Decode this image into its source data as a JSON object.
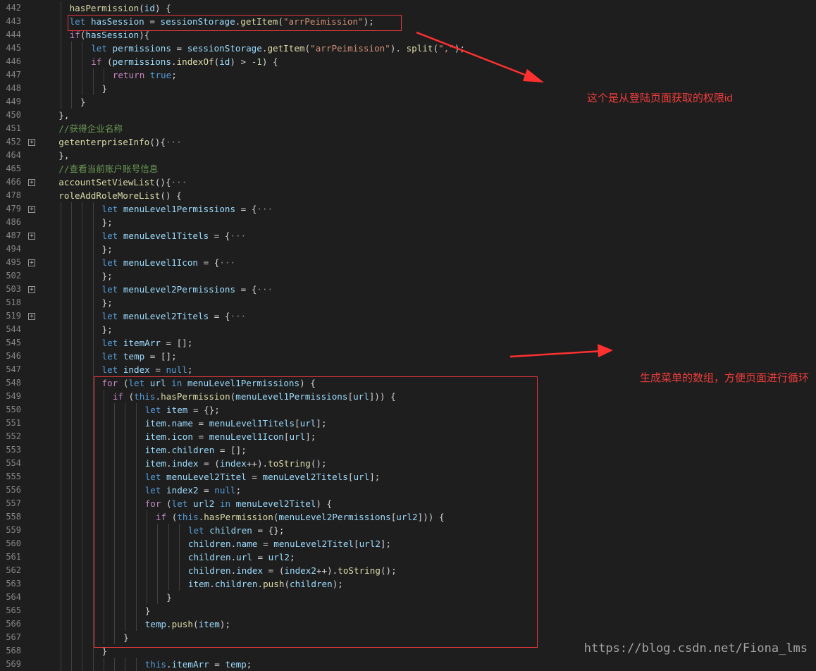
{
  "editor": {
    "lines": [
      {
        "n": "442",
        "fold": false,
        "indent": 3,
        "tokens": [
          [
            "fn",
            "hasPermission"
          ],
          [
            "p",
            "("
          ],
          [
            "vr",
            "id"
          ],
          [
            "p",
            ") {"
          ]
        ]
      },
      {
        "n": "443",
        "fold": false,
        "indent": 3,
        "tokens": [
          [
            "kw",
            "let "
          ],
          [
            "vr",
            "hasSession"
          ],
          [
            "p",
            " = "
          ],
          [
            "vr",
            "sessionStorage"
          ],
          [
            "p",
            "."
          ],
          [
            "fn",
            "getItem"
          ],
          [
            "p",
            "("
          ],
          [
            "str",
            "\"arrPeimission\""
          ],
          [
            "p",
            ");"
          ]
        ]
      },
      {
        "n": "444",
        "fold": false,
        "indent": 3,
        "tokens": [
          [
            "ctl",
            "if"
          ],
          [
            "p",
            "("
          ],
          [
            "vr",
            "hasSession"
          ],
          [
            "p",
            "){"
          ]
        ]
      },
      {
        "n": "445",
        "fold": false,
        "indent": 5,
        "tokens": [
          [
            "kw",
            "let "
          ],
          [
            "vr",
            "permissions"
          ],
          [
            "p",
            " = "
          ],
          [
            "vr",
            "sessionStorage"
          ],
          [
            "p",
            "."
          ],
          [
            "fn",
            "getItem"
          ],
          [
            "p",
            "("
          ],
          [
            "str",
            "\"arrPeimission\""
          ],
          [
            "p",
            "). "
          ],
          [
            "fn",
            "split"
          ],
          [
            "p",
            "("
          ],
          [
            "str",
            "\",\""
          ],
          [
            "p",
            ");"
          ]
        ]
      },
      {
        "n": "446",
        "fold": false,
        "indent": 5,
        "tokens": [
          [
            "ctl",
            "if "
          ],
          [
            "p",
            "("
          ],
          [
            "vr",
            "permissions"
          ],
          [
            "p",
            "."
          ],
          [
            "fn",
            "indexOf"
          ],
          [
            "p",
            "("
          ],
          [
            "vr",
            "id"
          ],
          [
            "p",
            ") > -"
          ],
          [
            "num",
            "1"
          ],
          [
            "p",
            ") {"
          ]
        ]
      },
      {
        "n": "447",
        "fold": false,
        "indent": 7,
        "tokens": [
          [
            "ctl",
            "return "
          ],
          [
            "kw",
            "true"
          ],
          [
            "p",
            ";"
          ]
        ]
      },
      {
        "n": "448",
        "fold": false,
        "indent": 6,
        "tokens": [
          [
            "p",
            "}"
          ]
        ]
      },
      {
        "n": "449",
        "fold": false,
        "indent": 4,
        "tokens": [
          [
            "p",
            "}"
          ]
        ]
      },
      {
        "n": "450",
        "fold": false,
        "indent": 2,
        "tokens": [
          [
            "p",
            "},"
          ]
        ]
      },
      {
        "n": "451",
        "fold": false,
        "indent": 2,
        "tokens": [
          [
            "cm",
            "//获得企业名称"
          ]
        ]
      },
      {
        "n": "452",
        "fold": true,
        "indent": 2,
        "tokens": [
          [
            "fn",
            "getenterpriseInfo"
          ],
          [
            "p",
            "(){"
          ],
          [
            "el",
            "···"
          ]
        ]
      },
      {
        "n": "464",
        "fold": false,
        "indent": 2,
        "tokens": [
          [
            "p",
            "},"
          ]
        ]
      },
      {
        "n": "465",
        "fold": false,
        "indent": 2,
        "tokens": [
          [
            "cm",
            "//查看当前账户账号信息"
          ]
        ]
      },
      {
        "n": "466",
        "fold": true,
        "indent": 2,
        "tokens": [
          [
            "fn",
            "accountSetViewList"
          ],
          [
            "p",
            "(){"
          ],
          [
            "el",
            "···"
          ]
        ]
      },
      {
        "n": "478",
        "fold": false,
        "indent": 2,
        "tokens": [
          [
            "fn",
            "roleAddRoleMoreList"
          ],
          [
            "p",
            "() {"
          ]
        ]
      },
      {
        "n": "479",
        "fold": true,
        "indent": 6,
        "tokens": [
          [
            "kw",
            "let "
          ],
          [
            "vr",
            "menuLevel1Permissions"
          ],
          [
            "p",
            " = {"
          ],
          [
            "el",
            "···"
          ]
        ]
      },
      {
        "n": "486",
        "fold": false,
        "indent": 6,
        "tokens": [
          [
            "p",
            "};"
          ]
        ]
      },
      {
        "n": "487",
        "fold": true,
        "indent": 6,
        "tokens": [
          [
            "kw",
            "let "
          ],
          [
            "vr",
            "menuLevel1Titels"
          ],
          [
            "p",
            " = {"
          ],
          [
            "el",
            "···"
          ]
        ]
      },
      {
        "n": "494",
        "fold": false,
        "indent": 6,
        "tokens": [
          [
            "p",
            "};"
          ]
        ]
      },
      {
        "n": "495",
        "fold": true,
        "indent": 6,
        "tokens": [
          [
            "kw",
            "let "
          ],
          [
            "vr",
            "menuLevel1Icon"
          ],
          [
            "p",
            " = {"
          ],
          [
            "el",
            "···"
          ]
        ]
      },
      {
        "n": "502",
        "fold": false,
        "indent": 6,
        "tokens": [
          [
            "p",
            "};"
          ]
        ]
      },
      {
        "n": "503",
        "fold": true,
        "indent": 6,
        "tokens": [
          [
            "kw",
            "let "
          ],
          [
            "vr",
            "menuLevel2Permissions"
          ],
          [
            "p",
            " = {"
          ],
          [
            "el",
            "···"
          ]
        ]
      },
      {
        "n": "518",
        "fold": false,
        "indent": 6,
        "tokens": [
          [
            "p",
            "};"
          ]
        ]
      },
      {
        "n": "519",
        "fold": true,
        "indent": 6,
        "tokens": [
          [
            "kw",
            "let "
          ],
          [
            "vr",
            "menuLevel2Titels"
          ],
          [
            "p",
            " = {"
          ],
          [
            "el",
            "···"
          ]
        ]
      },
      {
        "n": "544",
        "fold": false,
        "indent": 6,
        "tokens": [
          [
            "p",
            "};"
          ]
        ]
      },
      {
        "n": "545",
        "fold": false,
        "indent": 6,
        "tokens": [
          [
            "kw",
            "let "
          ],
          [
            "vr",
            "itemArr"
          ],
          [
            "p",
            " = [];"
          ]
        ]
      },
      {
        "n": "546",
        "fold": false,
        "indent": 6,
        "tokens": [
          [
            "kw",
            "let "
          ],
          [
            "vr",
            "temp"
          ],
          [
            "p",
            " = [];"
          ]
        ]
      },
      {
        "n": "547",
        "fold": false,
        "indent": 6,
        "tokens": [
          [
            "kw",
            "let "
          ],
          [
            "vr",
            "index"
          ],
          [
            "p",
            " = "
          ],
          [
            "kw",
            "null"
          ],
          [
            "p",
            ";"
          ]
        ]
      },
      {
        "n": "548",
        "fold": false,
        "indent": 6,
        "tokens": [
          [
            "ctl",
            "for "
          ],
          [
            "p",
            "("
          ],
          [
            "kw",
            "let "
          ],
          [
            "vr",
            "url"
          ],
          [
            "kw",
            " in "
          ],
          [
            "vr",
            "menuLevel1Permissions"
          ],
          [
            "p",
            ") {"
          ]
        ]
      },
      {
        "n": "549",
        "fold": false,
        "indent": 7,
        "tokens": [
          [
            "ctl",
            "if "
          ],
          [
            "p",
            "("
          ],
          [
            "kw",
            "this"
          ],
          [
            "p",
            "."
          ],
          [
            "fn",
            "hasPermission"
          ],
          [
            "p",
            "("
          ],
          [
            "vr",
            "menuLevel1Permissions"
          ],
          [
            "p",
            "["
          ],
          [
            "vr",
            "url"
          ],
          [
            "p",
            "])) {"
          ]
        ]
      },
      {
        "n": "550",
        "fold": false,
        "indent": 10,
        "tokens": [
          [
            "kw",
            "let "
          ],
          [
            "vr",
            "item"
          ],
          [
            "p",
            " = {};"
          ]
        ]
      },
      {
        "n": "551",
        "fold": false,
        "indent": 10,
        "tokens": [
          [
            "vr",
            "item"
          ],
          [
            "p",
            "."
          ],
          [
            "vr",
            "name"
          ],
          [
            "p",
            " = "
          ],
          [
            "vr",
            "menuLevel1Titels"
          ],
          [
            "p",
            "["
          ],
          [
            "vr",
            "url"
          ],
          [
            "p",
            "];"
          ]
        ]
      },
      {
        "n": "552",
        "fold": false,
        "indent": 10,
        "tokens": [
          [
            "vr",
            "item"
          ],
          [
            "p",
            "."
          ],
          [
            "vr",
            "icon"
          ],
          [
            "p",
            " = "
          ],
          [
            "vr",
            "menuLevel1Icon"
          ],
          [
            "p",
            "["
          ],
          [
            "vr",
            "url"
          ],
          [
            "p",
            "];"
          ]
        ]
      },
      {
        "n": "553",
        "fold": false,
        "indent": 10,
        "tokens": [
          [
            "vr",
            "item"
          ],
          [
            "p",
            "."
          ],
          [
            "vr",
            "children"
          ],
          [
            "p",
            " = [];"
          ]
        ]
      },
      {
        "n": "554",
        "fold": false,
        "indent": 10,
        "tokens": [
          [
            "vr",
            "item"
          ],
          [
            "p",
            "."
          ],
          [
            "vr",
            "index"
          ],
          [
            "p",
            " = ("
          ],
          [
            "vr",
            "index"
          ],
          [
            "p",
            "++)."
          ],
          [
            "fn",
            "toString"
          ],
          [
            "p",
            "();"
          ]
        ]
      },
      {
        "n": "555",
        "fold": false,
        "indent": 10,
        "tokens": [
          [
            "kw",
            "let "
          ],
          [
            "vr",
            "menuLevel2Titel"
          ],
          [
            "p",
            " = "
          ],
          [
            "vr",
            "menuLevel2Titels"
          ],
          [
            "p",
            "["
          ],
          [
            "vr",
            "url"
          ],
          [
            "p",
            "];"
          ]
        ]
      },
      {
        "n": "556",
        "fold": false,
        "indent": 10,
        "tokens": [
          [
            "kw",
            "let "
          ],
          [
            "vr",
            "index2"
          ],
          [
            "p",
            " = "
          ],
          [
            "kw",
            "null"
          ],
          [
            "p",
            ";"
          ]
        ]
      },
      {
        "n": "557",
        "fold": false,
        "indent": 10,
        "tokens": [
          [
            "ctl",
            "for "
          ],
          [
            "p",
            "("
          ],
          [
            "kw",
            "let "
          ],
          [
            "vr",
            "url2"
          ],
          [
            "kw",
            " in "
          ],
          [
            "vr",
            "menuLevel2Titel"
          ],
          [
            "p",
            ") {"
          ]
        ]
      },
      {
        "n": "558",
        "fold": false,
        "indent": 11,
        "tokens": [
          [
            "ctl",
            "if "
          ],
          [
            "p",
            "("
          ],
          [
            "kw",
            "this"
          ],
          [
            "p",
            "."
          ],
          [
            "fn",
            "hasPermission"
          ],
          [
            "p",
            "("
          ],
          [
            "vr",
            "menuLevel2Permissions"
          ],
          [
            "p",
            "["
          ],
          [
            "vr",
            "url2"
          ],
          [
            "p",
            "])) {"
          ]
        ]
      },
      {
        "n": "559",
        "fold": false,
        "indent": 14,
        "tokens": [
          [
            "kw",
            "let "
          ],
          [
            "vr",
            "children"
          ],
          [
            "p",
            " = {};"
          ]
        ]
      },
      {
        "n": "560",
        "fold": false,
        "indent": 14,
        "tokens": [
          [
            "vr",
            "children"
          ],
          [
            "p",
            "."
          ],
          [
            "vr",
            "name"
          ],
          [
            "p",
            " = "
          ],
          [
            "vr",
            "menuLevel2Titel"
          ],
          [
            "p",
            "["
          ],
          [
            "vr",
            "url2"
          ],
          [
            "p",
            "];"
          ]
        ]
      },
      {
        "n": "561",
        "fold": false,
        "indent": 14,
        "tokens": [
          [
            "vr",
            "children"
          ],
          [
            "p",
            "."
          ],
          [
            "vr",
            "url"
          ],
          [
            "p",
            " = "
          ],
          [
            "vr",
            "url2"
          ],
          [
            "p",
            ";"
          ]
        ]
      },
      {
        "n": "562",
        "fold": false,
        "indent": 14,
        "tokens": [
          [
            "vr",
            "children"
          ],
          [
            "p",
            "."
          ],
          [
            "vr",
            "index"
          ],
          [
            "p",
            " = ("
          ],
          [
            "vr",
            "index2"
          ],
          [
            "p",
            "++)."
          ],
          [
            "fn",
            "toString"
          ],
          [
            "p",
            "();"
          ]
        ]
      },
      {
        "n": "563",
        "fold": false,
        "indent": 14,
        "tokens": [
          [
            "vr",
            "item"
          ],
          [
            "p",
            "."
          ],
          [
            "vr",
            "children"
          ],
          [
            "p",
            "."
          ],
          [
            "fn",
            "push"
          ],
          [
            "p",
            "("
          ],
          [
            "vr",
            "children"
          ],
          [
            "p",
            ");"
          ]
        ]
      },
      {
        "n": "564",
        "fold": false,
        "indent": 12,
        "tokens": [
          [
            "p",
            "}"
          ]
        ]
      },
      {
        "n": "565",
        "fold": false,
        "indent": 10,
        "tokens": [
          [
            "p",
            "}"
          ]
        ]
      },
      {
        "n": "566",
        "fold": false,
        "indent": 10,
        "tokens": [
          [
            "vr",
            "temp"
          ],
          [
            "p",
            "."
          ],
          [
            "fn",
            "push"
          ],
          [
            "p",
            "("
          ],
          [
            "vr",
            "item"
          ],
          [
            "p",
            ");"
          ]
        ]
      },
      {
        "n": "567",
        "fold": false,
        "indent": 8,
        "tokens": [
          [
            "p",
            "}"
          ]
        ]
      },
      {
        "n": "568",
        "fold": false,
        "indent": 6,
        "tokens": [
          [
            "p",
            "}"
          ]
        ]
      },
      {
        "n": "569",
        "fold": false,
        "indent": 10,
        "tokens": [
          [
            "kw",
            "this"
          ],
          [
            "p",
            "."
          ],
          [
            "vr",
            "itemArr"
          ],
          [
            "p",
            " = "
          ],
          [
            "vr",
            "temp"
          ],
          [
            "p",
            ";"
          ]
        ]
      }
    ]
  },
  "annotations": {
    "note_1": "这个是从登陆页面获取的权限id",
    "note_2": "生成菜单的数组，方便页面进行循环",
    "color": "#e8383d"
  },
  "watermark": "https://blog.csdn.net/Fiona_lms"
}
